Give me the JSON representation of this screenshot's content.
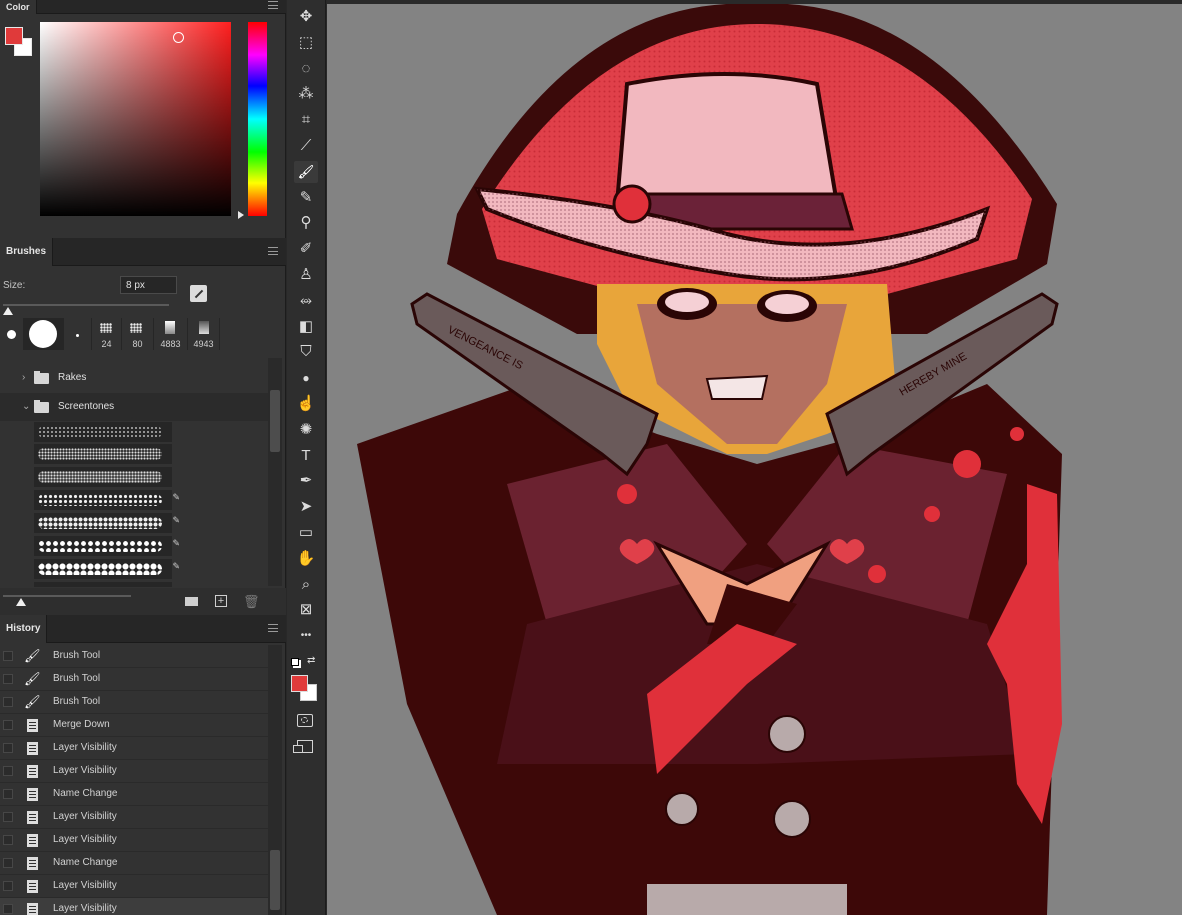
{
  "color_panel": {
    "tab_label": "Color",
    "foreground_color": "#e03a3a",
    "background_color": "#ffffff"
  },
  "brushes_panel": {
    "tab_label": "Brushes",
    "size_label": "Size:",
    "size_value": "8 px",
    "presets": [
      "",
      "",
      "",
      "24",
      "80",
      "4883",
      "4943"
    ],
    "folders": [
      {
        "label": "Rakes",
        "expanded": false
      },
      {
        "label": "Screentones",
        "expanded": true
      }
    ]
  },
  "history_panel": {
    "tab_label": "History",
    "items": [
      {
        "label": "Brush Tool",
        "icon": "brush-icon"
      },
      {
        "label": "Brush Tool",
        "icon": "brush-icon"
      },
      {
        "label": "Brush Tool",
        "icon": "brush-icon"
      },
      {
        "label": "Merge Down",
        "icon": "document-icon"
      },
      {
        "label": "Layer Visibility",
        "icon": "document-icon"
      },
      {
        "label": "Layer Visibility",
        "icon": "document-icon"
      },
      {
        "label": "Name Change",
        "icon": "document-icon"
      },
      {
        "label": "Layer Visibility",
        "icon": "document-icon"
      },
      {
        "label": "Layer Visibility",
        "icon": "document-icon"
      },
      {
        "label": "Name Change",
        "icon": "document-icon"
      },
      {
        "label": "Layer Visibility",
        "icon": "document-icon"
      },
      {
        "label": "Layer Visibility",
        "icon": "document-icon"
      }
    ]
  },
  "toolbar": {
    "tools": [
      "move-icon",
      "marquee-icon",
      "lasso-icon",
      "magic-wand-icon",
      "crop-icon",
      "eyedropper-icon",
      "brush-icon",
      "pencil-icon",
      "clone-stamp-icon",
      "history-brush-icon",
      "stamp-icon",
      "smudge-brush-icon",
      "eraser-icon",
      "paint-bucket-icon",
      "blur-icon",
      "finger-icon",
      "sponge-icon",
      "type-icon",
      "pen-icon",
      "path-selection-icon",
      "rectangle-icon",
      "hand-icon",
      "zoom-icon",
      "frame-icon",
      "more-icon"
    ],
    "active_tool": "brush-icon"
  },
  "canvas": {
    "background": "#838383",
    "artwork_text_left": "VENGEANCE IS",
    "artwork_text_right": "HEREBY MINE"
  }
}
